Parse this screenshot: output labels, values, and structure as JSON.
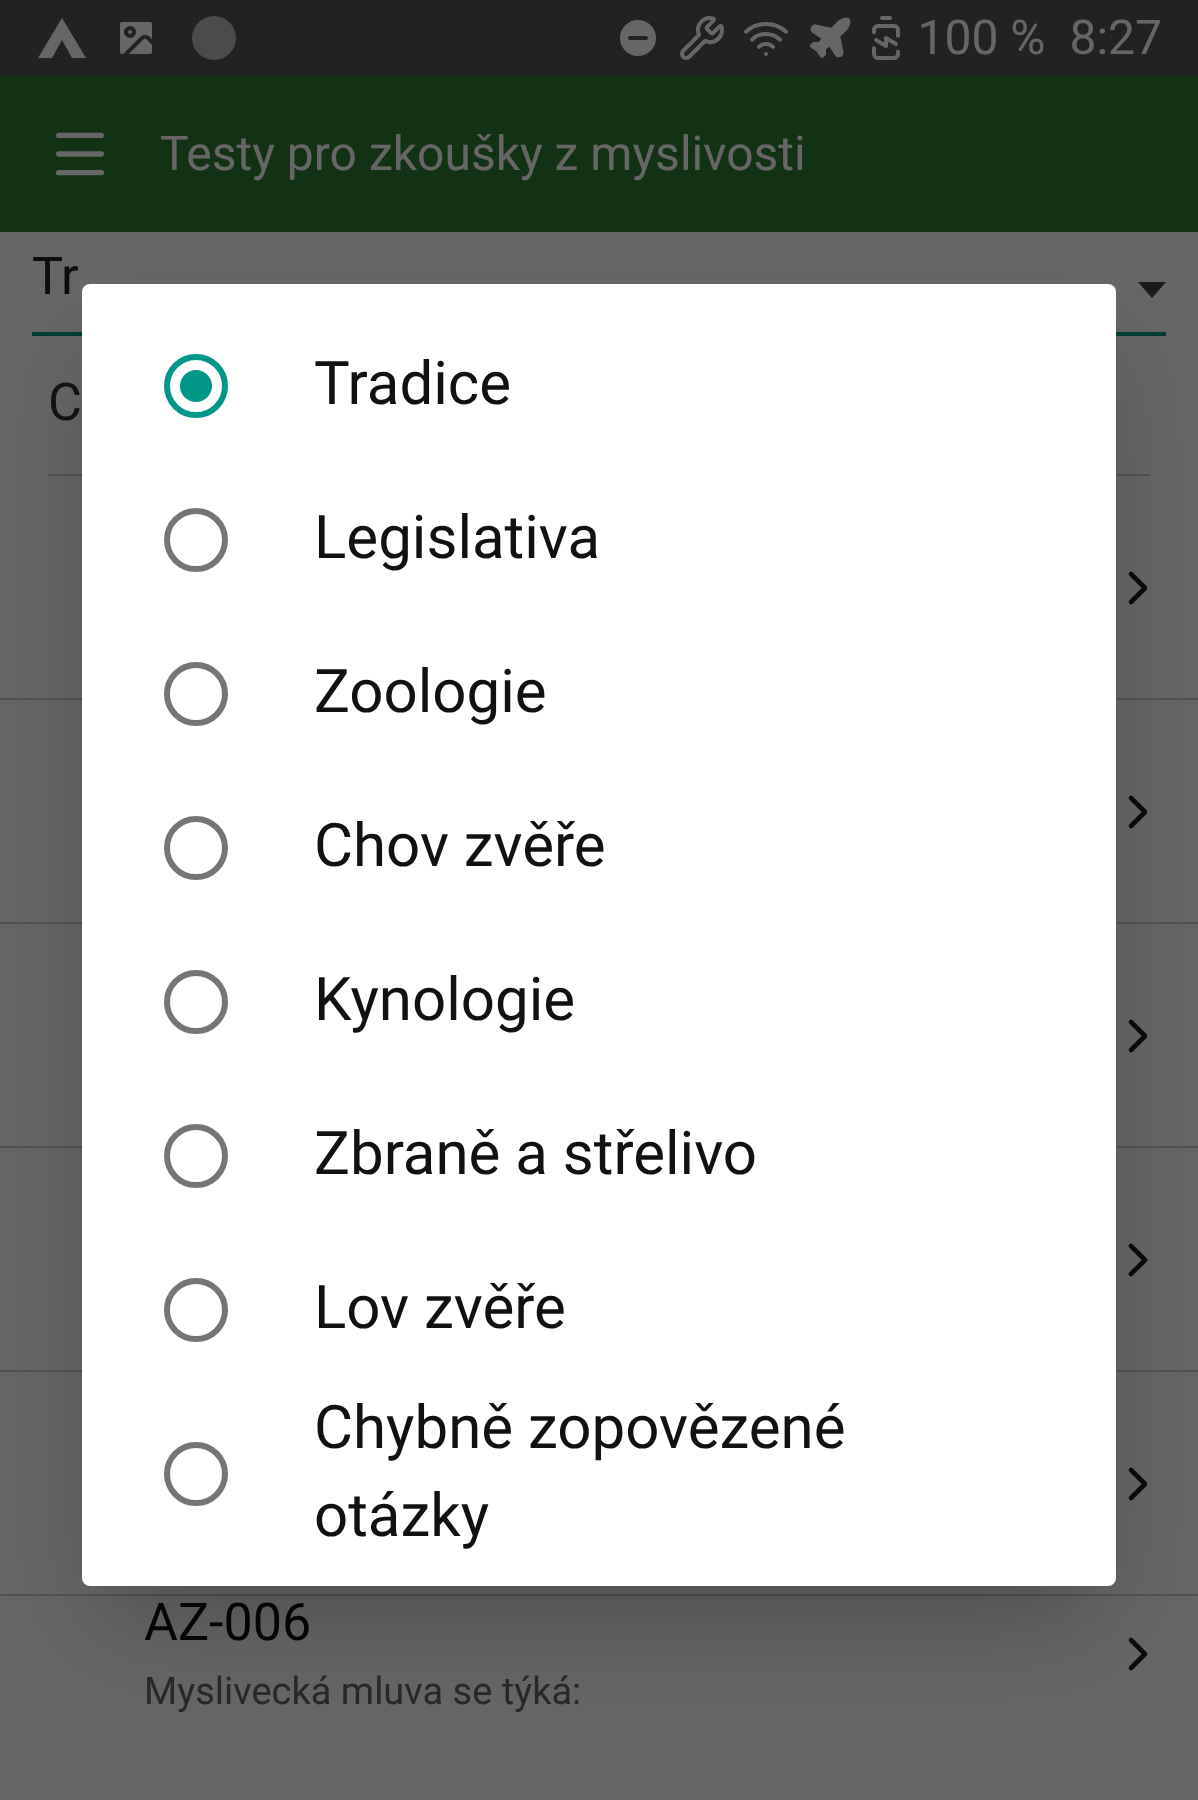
{
  "status_bar": {
    "battery": "100 %",
    "time": "8:27"
  },
  "app_bar": {
    "title": "Testy pro zkoušky z myslivosti"
  },
  "category_spinner": {
    "value": "Tr"
  },
  "filter_row": {
    "text": "C"
  },
  "questions": [
    {
      "code": "AZ-006",
      "text": "Myslivecká mluva se týká:"
    }
  ],
  "dialog": {
    "options": [
      {
        "label": "Tradice",
        "selected": true
      },
      {
        "label": "Legislativa",
        "selected": false
      },
      {
        "label": "Zoologie",
        "selected": false
      },
      {
        "label": "Chov zvěře",
        "selected": false
      },
      {
        "label": "Kynologie",
        "selected": false
      },
      {
        "label": "Zbraně a střelivo",
        "selected": false
      },
      {
        "label": "Lov zvěře",
        "selected": false
      },
      {
        "label": "Chybně zopovězené otázky",
        "selected": false
      }
    ]
  }
}
